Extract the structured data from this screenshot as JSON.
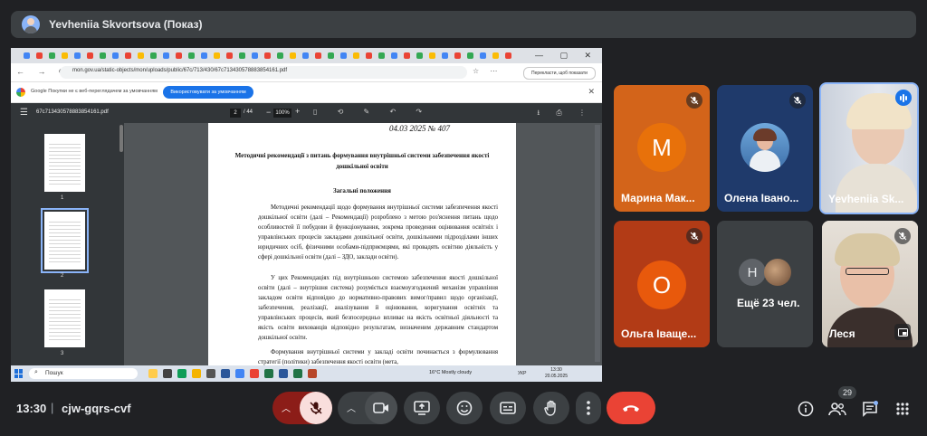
{
  "presenter": {
    "name": "Yevheniia Skvortsova (Показ)"
  },
  "browser": {
    "url": "mon.gov.ua/static-objects/mon/uploads/public/67c/713/430/67c713430578883854161.pdf",
    "translate_label": "Перекласти, щоб показати",
    "notification": {
      "text": "Google Покупки не є веб-переглядачем за умовчанням",
      "button": "Використовувати за умовчанням"
    }
  },
  "pdf": {
    "filename": "67c713430578883854161.pdf",
    "page_current": "2",
    "page_total": "/ 44",
    "zoom": "100%",
    "thumbnails": [
      "1",
      "2",
      "3"
    ]
  },
  "document": {
    "date_line": "04.03  2025 № 407",
    "title": "Методичні рекомендації з питань формування внутрішньої системи забезпечення якості дошкільної освіти",
    "section": "Загальні положення",
    "paragraphs": [
      "Методичні рекомендації щодо формування внутрішньої системи забезпечення якості дошкільної освіти (далі – Рекомендації) розроблено з метою роз'яснення питань щодо особливостей її побудови й функціонування, зокрема проведення оцінювання освітніх і управлінських процесів закладами дошкільної освіти, дошкільними підрозділами інших юридичних осіб, фізичними особами-підприємцями, які провадять освітню діяльність у сфері дошкільної освіти (далі – ЗДО, заклади освіти).",
      "У цих Рекомендаціях під внутрішньою системою забезпечення якості дошкільної освіти (далі – внутрішня система) розуміється взаємоузгоджений механізм управління закладом освіти відповідно до нормативно-правових вимог/правил щодо організації, забезпечення, реалізації, аналізування й оцінювання, коригування освітніх та управлінських процесів, який безпосередньо впливає на якість освітньої діяльності та якість освіти вихованців відповідно результатам, визначеним державним стандартом дошкільної освіти.",
      "Формування внутрішньої системи у закладі освіти починається з формулювання стратегії (політики) забезпечення якості освіти (мета,"
    ]
  },
  "taskbar": {
    "search": "Пошук",
    "weather": "16°C  Mostly cloudy",
    "lang": "УКР",
    "time": "13:30",
    "date": "20.05.2025"
  },
  "participants": [
    {
      "name": "Марина Мак...",
      "initial": "М"
    },
    {
      "name": "Олена Івано..."
    },
    {
      "name": "Yevheniia Sk..."
    },
    {
      "name": "Ольга Іваще...",
      "initial": "О"
    },
    {
      "name": "Ещё 23 чел.",
      "initial": "Н"
    },
    {
      "name": "Леся"
    }
  ],
  "meeting": {
    "time": "13:30",
    "separator": "|",
    "code": "cjw-gqrs-cvf",
    "people_count": "29"
  },
  "colors": {
    "leave": "#ea4335",
    "mic_off_bg": "#8c1d18",
    "accent": "#8ab4f8"
  }
}
